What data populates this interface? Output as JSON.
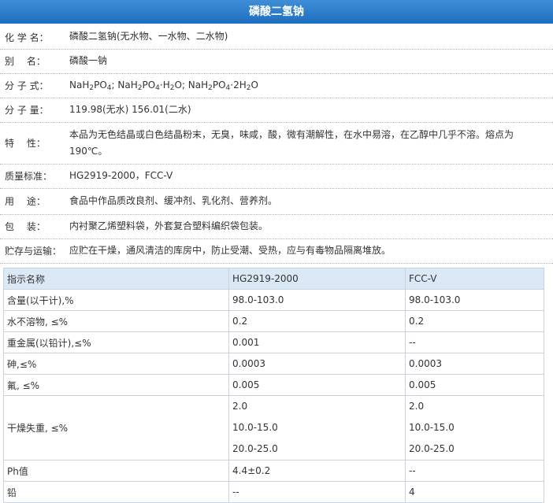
{
  "title": "磷酸二氢钠",
  "info": [
    {
      "label": "化 学 名：",
      "value": "磷酸二氢钠(无水物、一水物、二水物)"
    },
    {
      "label": "别　 名：",
      "value": "磷酸一钠"
    },
    {
      "label": "分 子 式：",
      "value": "NaH2PO4; NaH2PO4·H2O; NaH2PO4·2H2O"
    },
    {
      "label": "分 子 量：",
      "value": "119.98(无水) 156.01(二水)"
    },
    {
      "label": "特　 性：",
      "value": "本品为无色结晶或白色结晶粉末，无臭，味咸，酸，微有潮解性，在水中易溶，在乙醇中几乎不溶。熔点为190℃。"
    },
    {
      "label": "质量标准：",
      "value": "HG2919-2000，FCC-V"
    },
    {
      "label": "用　 途：",
      "value": "食品中作品质改良剂、缓冲剂、乳化剂、营养剂。"
    },
    {
      "label": "包　 装：",
      "value": "内衬聚乙烯塑料袋，外套复合塑料编织袋包装。"
    },
    {
      "label": "贮存与运输：",
      "value": "应贮在干燥，通风清洁的库房中，防止受潮、受热，应与有毒物品隔离堆放。"
    }
  ],
  "formula_parts": {
    "p1": "NaH",
    "s1": "2",
    "p2": "PO",
    "s2": "4",
    "sep1": "; NaH",
    "s3": "2",
    "p3": "PO",
    "s4": "4",
    "p4": "·H",
    "s5": "2",
    "p5": "O; NaH",
    "s6": "2",
    "p6": "PO",
    "s7": "4",
    "p7": "·2H",
    "s8": "2",
    "p8": "O"
  },
  "table": {
    "headers": [
      "指示名称",
      "HG2919-2000",
      "FCC-V"
    ],
    "rows": [
      {
        "name": "含量(以干计),%",
        "hg": "98.0-103.0",
        "fcc": "98.0-103.0"
      },
      {
        "name": "水不溶物, ≤%",
        "hg": "0.2",
        "fcc": "0.2"
      },
      {
        "name": "重金属(以铅计),≤%",
        "hg": "0.001",
        "fcc": "--"
      },
      {
        "name": "砷,≤%",
        "hg": "0.0003",
        "fcc": "0.0003"
      },
      {
        "name": "氟, ≤%",
        "hg": "0.005",
        "fcc": "0.005"
      }
    ],
    "drying": {
      "name": "干燥失重, ≤%",
      "hg": [
        "2.0",
        "10.0-15.0",
        "20.0-25.0"
      ],
      "fcc": [
        "2.0",
        "10.0-15.0",
        "20.0-25.0"
      ]
    },
    "tail_rows": [
      {
        "name": "Ph值",
        "hg": "4.4±0.2",
        "fcc": "--"
      },
      {
        "name": "铅",
        "hg": "--",
        "fcc": "4"
      }
    ]
  }
}
